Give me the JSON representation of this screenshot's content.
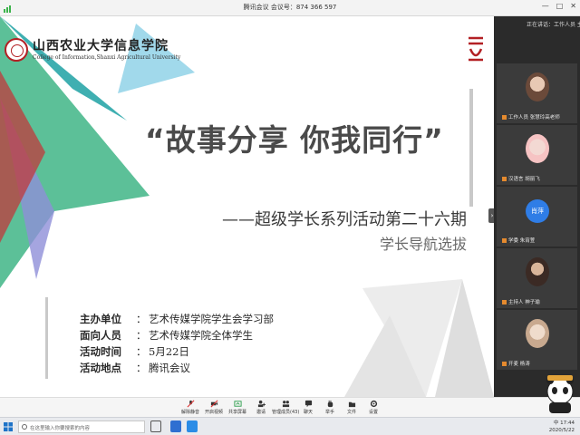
{
  "meeting": {
    "title": "腾讯会议 会议号：874 366 597"
  },
  "window": {
    "minimize": "—",
    "maximize": "□",
    "close": "✕"
  },
  "slide": {
    "logo_cn": "山西农业大学信息学院",
    "logo_en": "College of Information,Shanxi Agricultural University",
    "title": "“故事分享 你我同行”",
    "subtitle": "——超级学长系列活动第二十六期",
    "subtitle2": "学长导航选拔",
    "info": [
      {
        "key": "主办单位",
        "colon": "：",
        "value": "艺术传媒学院学生会学习部"
      },
      {
        "key": "面向人员",
        "colon": "：",
        "value": "艺术传媒学院全体学生"
      },
      {
        "key": "活动时间",
        "colon": "：",
        "value": "5月22日"
      },
      {
        "key": "活动地点",
        "colon": "：",
        "value": "腾讯会议"
      }
    ]
  },
  "panel": {
    "header": "正在讲话：工作人员  主持",
    "participants": [
      {
        "name": "工作人员 张慧玲高老师"
      },
      {
        "name": "汉语言 胡丽飞"
      },
      {
        "name": "学委 朱宵萱",
        "badge": "肖萍"
      },
      {
        "name": "主持人 神子瑜"
      },
      {
        "name": "开麦 杨涛"
      }
    ]
  },
  "toolbar": {
    "items": [
      "解除静音",
      "开启视频",
      "共享屏幕",
      "邀请",
      "管理成员(43)",
      "聊天",
      "举手",
      "文件",
      "设置"
    ]
  },
  "taskbar": {
    "search_placeholder": "在这里输入你要搜索的内容",
    "time": "17:44",
    "date": "2020/5/22",
    "ime": "中"
  },
  "colors": {
    "accent_red": "#c0393b",
    "accent_green": "#3fb586",
    "accent_teal": "#2aa6a8",
    "accent_purple": "#8f8fd8",
    "badge_blue": "#2f7de6"
  }
}
